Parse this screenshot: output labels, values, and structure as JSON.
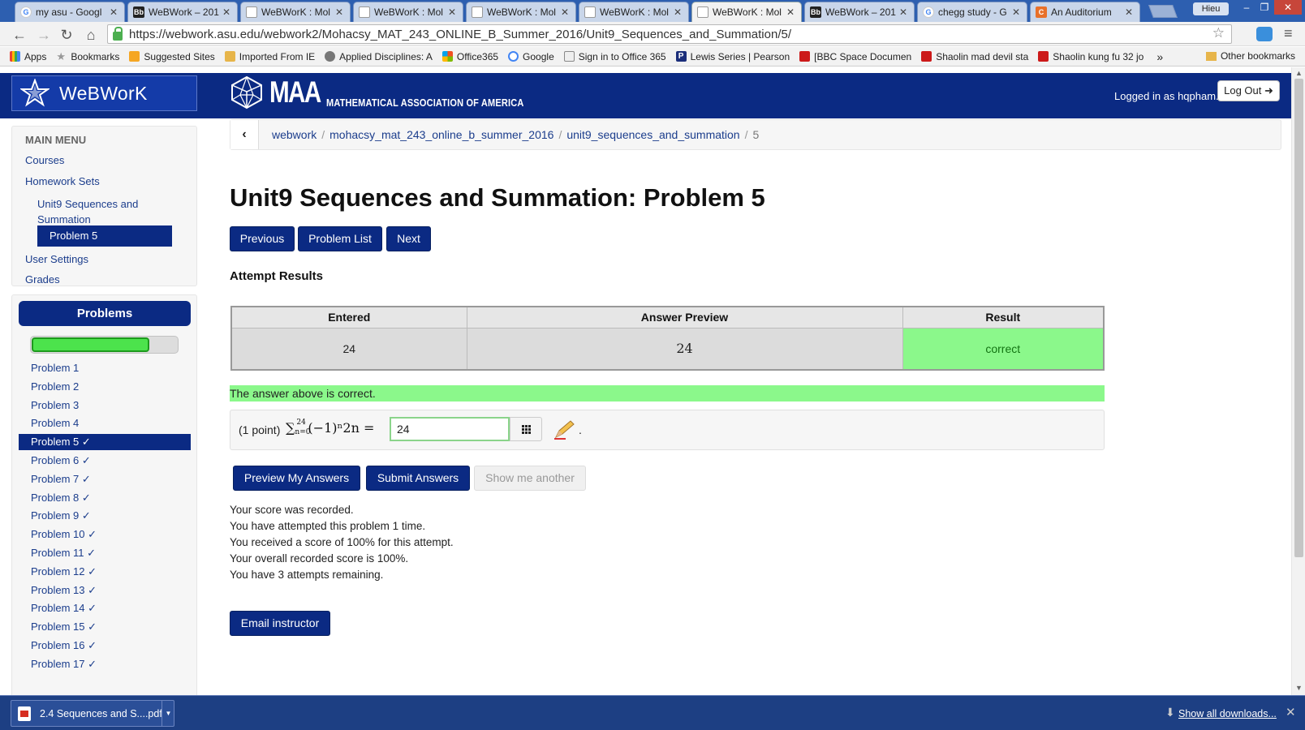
{
  "browser": {
    "tabs": [
      {
        "title": "my asu - Googl",
        "favicon": "google-icon"
      },
      {
        "title": "WeBWork – 201",
        "favicon": "blackboard-icon"
      },
      {
        "title": "WeBWorK : Mol",
        "favicon": "document-icon"
      },
      {
        "title": "WeBWorK : Mol",
        "favicon": "document-icon"
      },
      {
        "title": "WeBWorK : Mol",
        "favicon": "document-icon"
      },
      {
        "title": "WeBWorK : Mol",
        "favicon": "document-icon"
      },
      {
        "title": "WeBWorK : Mol",
        "favicon": "document-icon"
      },
      {
        "title": "WeBWork – 201",
        "favicon": "blackboard-icon"
      },
      {
        "title": "chegg study - G",
        "favicon": "google-icon"
      },
      {
        "title": "An Auditorium",
        "favicon": "chegg-icon"
      }
    ],
    "active_tab_index": 6,
    "profile_name": "Hieu",
    "url": "https://webwork.asu.edu/webwork2/Mohacsy_MAT_243_ONLINE_B_Summer_2016/Unit9_Sequences_and_Summation/5/",
    "bookmarks": [
      {
        "label": "Apps",
        "icon": "apps-icon"
      },
      {
        "label": "Bookmarks",
        "icon": "star-icon"
      },
      {
        "label": "Suggested Sites",
        "icon": "suggested-sites-icon"
      },
      {
        "label": "Imported From IE",
        "icon": "folder-icon"
      },
      {
        "label": "Applied Disciplines: A",
        "icon": "site-icon"
      },
      {
        "label": "Office365",
        "icon": "microsoft-icon"
      },
      {
        "label": "Google",
        "icon": "google-icon"
      },
      {
        "label": "Sign in to Office 365",
        "icon": "office-icon"
      },
      {
        "label": "Lewis Series | Pearson",
        "icon": "pearson-icon"
      },
      {
        "label": "[BBC Space Documen",
        "icon": "youtube-icon"
      },
      {
        "label": "Shaolin mad devil sta",
        "icon": "youtube-icon"
      },
      {
        "label": "Shaolin kung fu 32 jo",
        "icon": "youtube-icon"
      }
    ],
    "bookmarks_overflow": "»",
    "other_bookmarks": "Other bookmarks"
  },
  "header": {
    "brand": "WeBWorK",
    "maa_big": "MAA",
    "maa_small": "MATHEMATICAL ASSOCIATION OF AMERICA",
    "logged_in": "Logged in as hqpham.",
    "logout": "Log Out"
  },
  "menu": {
    "title": "MAIN MENU",
    "courses": "Courses",
    "homework_sets": "Homework Sets",
    "set_name": "Unit9 Sequences and Summation",
    "current_problem": "Problem 5",
    "user_settings": "User Settings",
    "grades": "Grades"
  },
  "problems": {
    "header": "Problems",
    "progress": 0.8,
    "items": [
      "Problem 1",
      "Problem 2",
      "Problem 3",
      "Problem 4",
      "Problem 5 ✓",
      "Problem 6 ✓",
      "Problem 7 ✓",
      "Problem 8 ✓",
      "Problem 9 ✓",
      "Problem 10 ✓",
      "Problem 11 ✓",
      "Problem 12 ✓",
      "Problem 13 ✓",
      "Problem 14 ✓",
      "Problem 15 ✓",
      "Problem 16 ✓",
      "Problem 17 ✓"
    ],
    "current_index": 4
  },
  "breadcrumb": {
    "items": [
      "webwork",
      "mohacsy_mat_243_online_b_summer_2016",
      "unit9_sequences_and_summation"
    ],
    "current": "5",
    "separator": "/"
  },
  "main": {
    "title": "Unit9 Sequences and Summation: Problem 5",
    "nav_buttons": {
      "previous": "Previous",
      "problem_list": "Problem List",
      "next": "Next"
    },
    "attempt_heading": "Attempt Results",
    "table": {
      "headers": [
        "Entered",
        "Answer Preview",
        "Result"
      ],
      "row": {
        "entered": "24",
        "preview": "24",
        "result": "correct"
      }
    },
    "correct_message": "The answer above is correct.",
    "problem": {
      "points": "(1 point)",
      "formula_sum": "∑",
      "formula_upper": "24",
      "formula_lower": "n=0",
      "formula_body": "(−1)ⁿ2n =",
      "answer_value": "24",
      "trailing": "."
    },
    "action_buttons": {
      "preview": "Preview My Answers",
      "submit": "Submit Answers",
      "show_another": "Show me another"
    },
    "score_lines": [
      "Your score was recorded.",
      "You have attempted this problem 1 time.",
      "You received a score of 100% for this attempt.",
      "Your overall recorded score is 100%.",
      "You have 3 attempts remaining."
    ],
    "email_button": "Email instructor"
  },
  "downloads": {
    "file": "2.4 Sequences and S....pdf",
    "show_all": "Show all downloads..."
  },
  "colors": {
    "navy": "#0b2a83",
    "correct_green": "#8bf88b",
    "link_blue": "#1b3d8c"
  }
}
